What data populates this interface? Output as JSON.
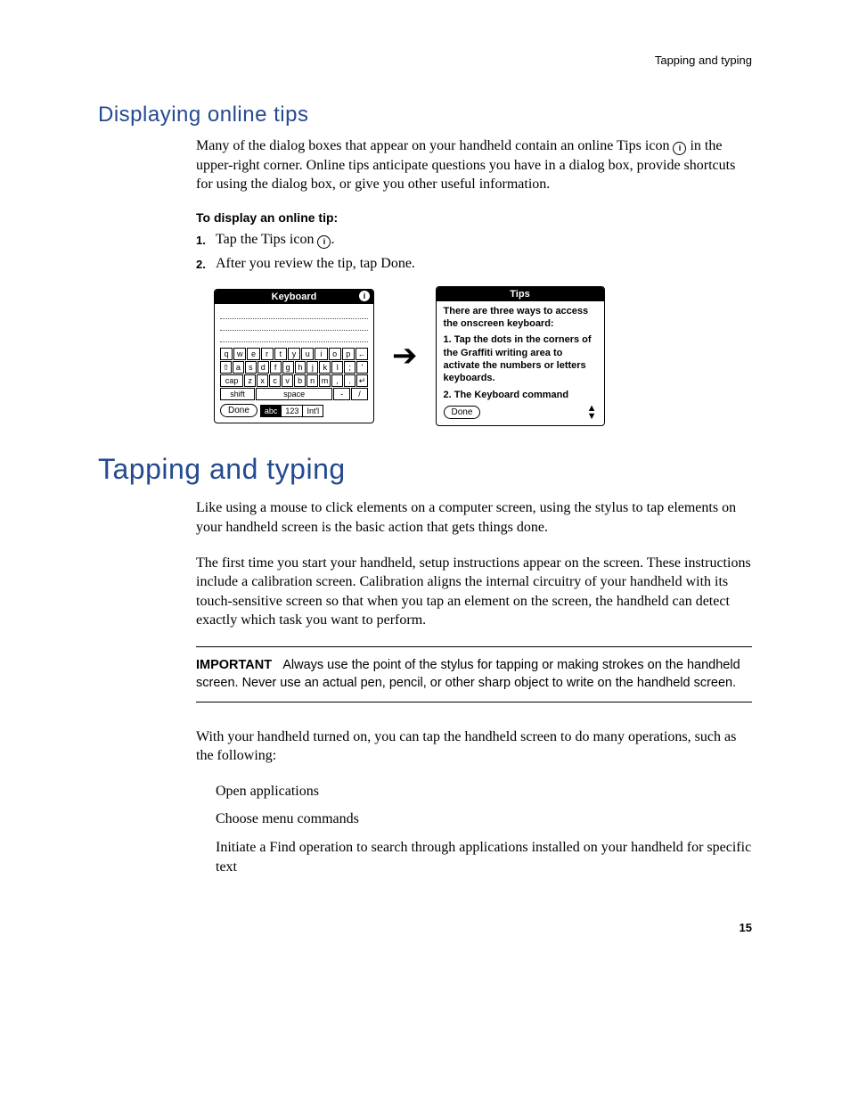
{
  "runningHead": "Tapping and typing",
  "pageNumber": "15",
  "section1": {
    "heading": "Displaying online tips",
    "body1": "Many of the dialog boxes that appear on your handheld contain an online Tips icon",
    "body1b": " in the upper-right corner. Online tips anticipate questions you have in a dialog box, provide shortcuts for using the dialog box, or give you other useful information.",
    "subhead": "To display an online tip:",
    "step1a": "Tap the Tips icon ",
    "step1b": ".",
    "step2": "After you review the tip, tap Done.",
    "keyboard": {
      "title": "Keyboard",
      "row1": [
        "q",
        "w",
        "e",
        "r",
        "t",
        "y",
        "u",
        "i",
        "o",
        "p",
        "←"
      ],
      "row2": [
        "⇧",
        "a",
        "s",
        "d",
        "f",
        "g",
        "h",
        "j",
        "k",
        "l",
        ";",
        "'"
      ],
      "row3": [
        "cap",
        "z",
        "x",
        "c",
        "v",
        "b",
        "n",
        "m",
        ",",
        ".",
        "↵"
      ],
      "shift": "shift",
      "space": "space",
      "dash": "-",
      "slash": "/",
      "done": "Done",
      "tabs": {
        "abc": "abc",
        "num": "123",
        "intl": "Int'l"
      }
    },
    "tips": {
      "title": "Tips",
      "p1": "There are three ways to access the onscreen keyboard:",
      "p2": "1. Tap the dots in the corners of the Graffiti writing area to activate the numbers or letters keyboards.",
      "p3": "2. The Keyboard command",
      "done": "Done"
    }
  },
  "section2": {
    "title": "Tapping and typing",
    "p1": "Like using a mouse to click elements on a computer screen, using the stylus to tap elements on your handheld screen is the basic action that gets things done.",
    "p2": "The first time you start your handheld, setup instructions appear on the screen. These instructions include a calibration screen. Calibration aligns the internal circuitry of your handheld with its touch-sensitive screen so that when you tap an element on the screen, the handheld can detect exactly which task you want to perform.",
    "importantLabel": "IMPORTANT",
    "important": "Always use the point of the stylus for tapping or making strokes on the handheld screen. Never use an actual pen, pencil, or other sharp object to write on the handheld screen.",
    "p3": "With your handheld turned on, you can tap the handheld screen to do many operations, such as the following:",
    "ops": [
      "Open applications",
      "Choose menu commands",
      "Initiate a Find operation to search through applications installed on your handheld for specific text"
    ]
  }
}
